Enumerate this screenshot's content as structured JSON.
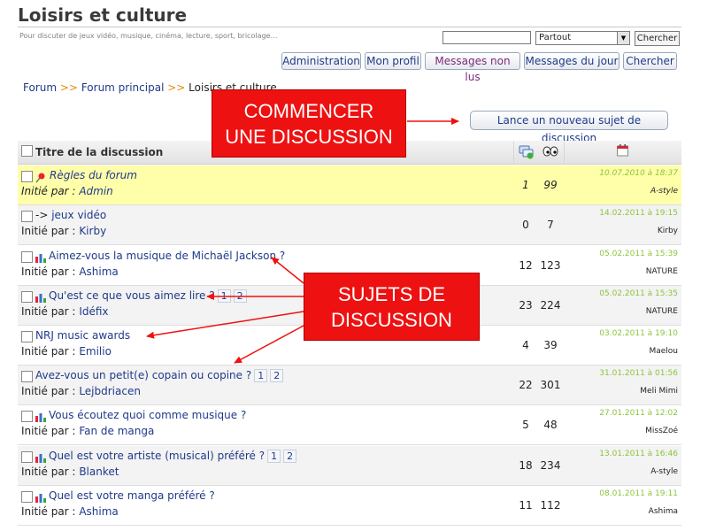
{
  "page": {
    "title": "Loisirs et culture",
    "description": "Pour discuter de jeux vidéo, musique, cinéma, lecture, sport, bricolage…"
  },
  "search": {
    "input_value": "",
    "scope_selected": "Partout",
    "button_label": "Chercher"
  },
  "nav_buttons": {
    "administration": "Administration",
    "profile": "Mon profil",
    "unread": "Messages non lus",
    "today": "Messages du jour",
    "search": "Chercher"
  },
  "breadcrumb": {
    "forum": "Forum",
    "separator": ">>",
    "main": "Forum principal",
    "current": "Loisirs et culture"
  },
  "new_topic_label": "Lance un nouveau sujet de discussion",
  "table_header": {
    "title": "Titre de la discussion",
    "replies_icon": "replies-icon",
    "views_icon": "views-icon",
    "date_icon": "calendar-icon"
  },
  "started_by_label": "Initié par :",
  "topics": [
    {
      "subject": "Règles du forum",
      "prefix": "",
      "icon": "pin-icon",
      "author": "Admin",
      "replies": "1",
      "views": "99",
      "last_date": "10.07.2010 à 18:37",
      "last_user": "A-style",
      "pages": [],
      "sticky": true
    },
    {
      "subject": "jeux vidéo",
      "prefix": "->",
      "icon": "",
      "author": "Kirby",
      "replies": "0",
      "views": "7",
      "last_date": "14.02.2011 à 19:15",
      "last_user": "Kirby",
      "pages": [],
      "sticky": false
    },
    {
      "subject": "Aimez-vous la musique de Michaël Jackson ?",
      "prefix": "",
      "icon": "poll-icon",
      "author": "Ashima",
      "replies": "12",
      "views": "123",
      "last_date": "05.02.2011 à 15:39",
      "last_user": "NATURE",
      "pages": [],
      "sticky": false
    },
    {
      "subject": "Qu'est ce que vous aimez lire ?",
      "prefix": "",
      "icon": "poll-icon",
      "author": "Idéfix",
      "replies": "23",
      "views": "224",
      "last_date": "05.02.2011 à 15:35",
      "last_user": "NATURE",
      "pages": [
        "1",
        "2"
      ],
      "sticky": false
    },
    {
      "subject": "NRJ music awards",
      "prefix": "",
      "icon": "",
      "author": "Emilio",
      "replies": "4",
      "views": "39",
      "last_date": "03.02.2011 à 19:10",
      "last_user": "Maelou",
      "pages": [],
      "sticky": false
    },
    {
      "subject": "Avez-vous un petit(e) copain ou copine ?",
      "prefix": "",
      "icon": "",
      "author": "Lejbdriacen",
      "replies": "22",
      "views": "301",
      "last_date": "31.01.2011 à 01:56",
      "last_user": "Meli Mimi",
      "pages": [
        "1",
        "2"
      ],
      "sticky": false
    },
    {
      "subject": "Vous écoutez quoi comme musique ?",
      "prefix": "",
      "icon": "poll-icon",
      "author": "Fan de manga",
      "replies": "5",
      "views": "48",
      "last_date": "27.01.2011 à 12:02",
      "last_user": "MissZoé",
      "pages": [],
      "sticky": false
    },
    {
      "subject": "Quel est votre artiste (musical) préféré ?",
      "prefix": "",
      "icon": "poll-icon",
      "author": "Blanket",
      "replies": "18",
      "views": "234",
      "last_date": "13.01.2011 à 16:46",
      "last_user": "A-style",
      "pages": [
        "1",
        "2"
      ],
      "sticky": false
    },
    {
      "subject": "Quel est votre manga préféré ?",
      "prefix": "",
      "icon": "poll-icon",
      "author": "Ashima",
      "replies": "11",
      "views": "112",
      "last_date": "08.01.2011 à 19:11",
      "last_user": "Ashima",
      "pages": [],
      "sticky": false
    }
  ],
  "annotations": {
    "start_discussion": [
      "COMMENCER",
      "UNE DISCUSSION"
    ],
    "discussion_topics": [
      "SUJETS DE",
      "DISCUSSION"
    ],
    "color": "#ee1111"
  },
  "colors": {
    "link": "#1f3a8a",
    "breadcrumb_separator": "#e68a00",
    "date": "#8cc43a",
    "sticky_background": "#ffffaa",
    "alt_row_background": "#f3f3f3"
  }
}
